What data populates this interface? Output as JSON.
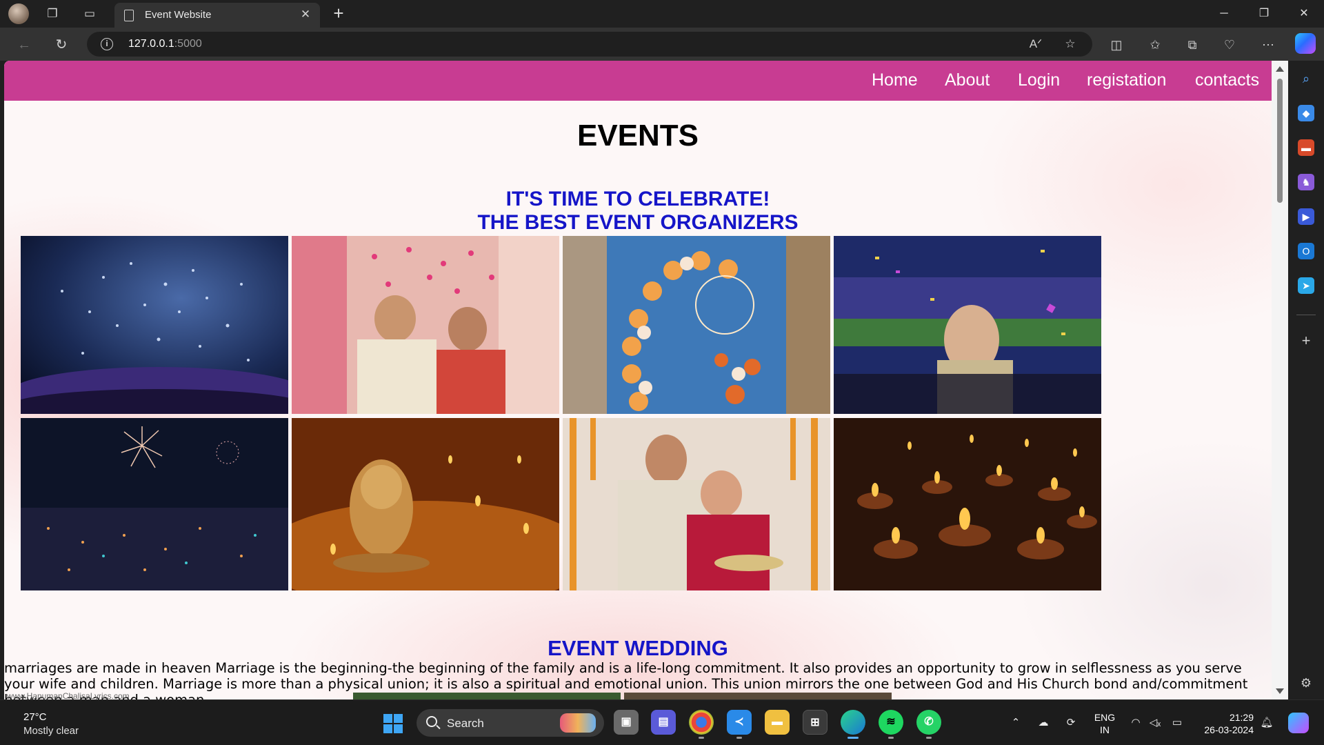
{
  "browser": {
    "tab_title": "Event Website",
    "url_host": "127.0.0.1",
    "url_port": ":5000"
  },
  "site": {
    "nav": [
      "Home",
      "About",
      "Login",
      "registation",
      "contacts"
    ],
    "title": "EVENTS",
    "tagline1": "IT'S TIME TO CELEBRATE!",
    "tagline2": "THE BEST EVENT ORGANIZERS",
    "section_heading": "EVENT WEDDING",
    "section_text": "marriages are made in heaven Marriage is the beginning-the beginning of the family and is a life-long commitment. It also provides an opportunity to grow in selflessness as you serve your wife and children. Marriage is more than a physical union; it is also a spiritual and emotional union. This union mirrors the one between God and His Church bond and/commitment between a man and a woman.",
    "watermark": "www.HanumanChalisaLyrics.com",
    "accent_color": "#c83c92",
    "heading_color": "#1515c8",
    "images": [
      "concert-confetti-photo",
      "wedding-ceremony-photo",
      "birthday-balloon-arch-photo",
      "stadium-celebration-photo",
      "fireworks-city-photo",
      "ganesha-candles-photo",
      "couple-surprise-photo",
      "diya-lamps-photo"
    ]
  },
  "taskbar": {
    "temperature": "27°C",
    "weather": "Mostly clear",
    "search_label": "Search",
    "lang_line1": "ENG",
    "lang_line2": "IN",
    "time": "21:29",
    "date": "26-03-2024"
  }
}
